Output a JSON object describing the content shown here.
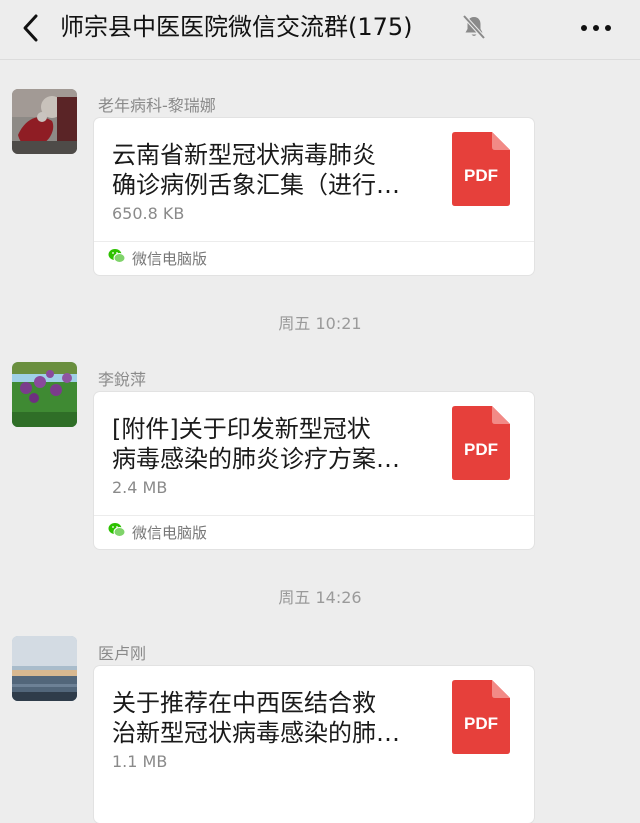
{
  "header": {
    "back_icon": "chevron-left-icon",
    "title": "师宗县中医医院微信交流群(175)",
    "mute_icon": "bell-muted-icon",
    "more_icon": "ellipsis-icon"
  },
  "messages": [
    {
      "sender": "老年病科-黎瑞娜",
      "file_title_line1": "云南省新型冠状病毒肺炎",
      "file_title_line2": "确诊病例舌象汇集（进行…",
      "file_size": "650.8 KB",
      "file_type": "PDF",
      "source": "微信电脑版"
    },
    {
      "timestamp": "周五 10:21",
      "sender": "李銳萍",
      "file_title_line1": "[附件]关于印发新型冠状",
      "file_title_line2": "病毒感染的肺炎诊疗方案…",
      "file_size": "2.4 MB",
      "file_type": "PDF",
      "source": "微信电脑版"
    },
    {
      "timestamp": "周五 14:26",
      "sender": "医卢刚",
      "file_title_line1": "关于推荐在中西医结合救",
      "file_title_line2": "治新型冠状病毒感染的肺…",
      "file_size": "1.1 MB",
      "file_type": "PDF"
    }
  ],
  "colors": {
    "background": "#ededed",
    "card": "#ffffff",
    "pdf_red": "#e6403b",
    "wechat_green": "#2dc100"
  }
}
